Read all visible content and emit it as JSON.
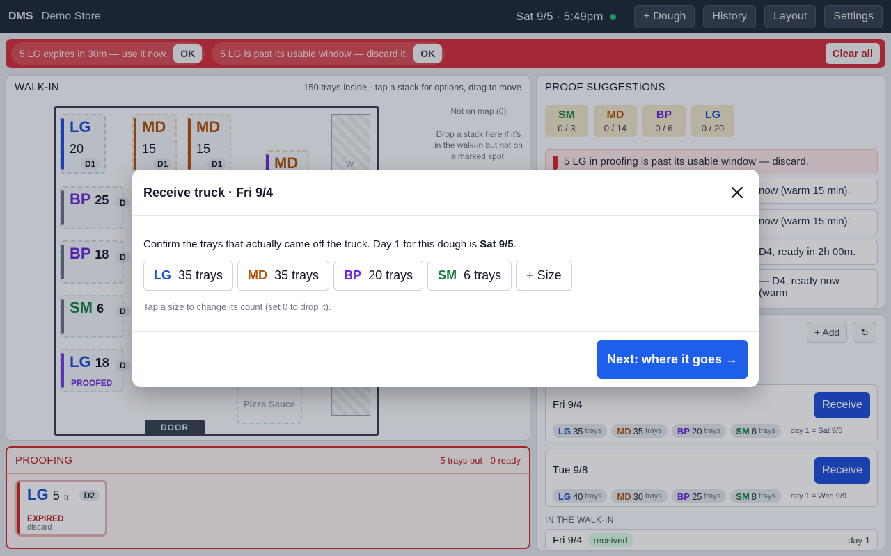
{
  "topbar": {
    "brand": "DMS",
    "store": "Demo Store",
    "datetime": "Sat 9/5 · 5:49pm",
    "buttons": {
      "dough": "+ Dough",
      "history": "History",
      "layout": "Layout",
      "settings": "Settings"
    }
  },
  "alerts": {
    "items": [
      {
        "text": "5 LG expires in 30m — use it now.",
        "ok": "OK"
      },
      {
        "text": "5 LG is past its usable window — discard it.",
        "ok": "OK"
      }
    ],
    "clear_all": "Clear all"
  },
  "walkin": {
    "title": "WALK-IN",
    "meta": "150 trays inside · tap a stack for options, drag to move",
    "stacks": [
      {
        "size": "LG",
        "count": "20",
        "day": "D1"
      },
      {
        "size": "MD",
        "count": "15",
        "day": "D1"
      },
      {
        "size": "MD",
        "count": "15",
        "day": "D1"
      },
      {
        "size": "MD",
        "count": "",
        "day": ""
      },
      {
        "size": "BP",
        "count": "25",
        "day": "D"
      },
      {
        "size": "BP",
        "count": "18",
        "day": "D"
      },
      {
        "size": "SM",
        "count": "6",
        "day": "D"
      },
      {
        "size": "LG",
        "count": "18",
        "day": "D",
        "status": "PROOFED"
      }
    ],
    "wall_label": "W",
    "door": "DOOR",
    "sauce": "Pizza Sauce",
    "not_on_map": "Not on map (0)",
    "not_on_map_help": "Drop a stack here if it's in the walk-in but not on a marked spot."
  },
  "proofing": {
    "title": "PROOFING",
    "meta": "5 trays out · 0 ready",
    "card": {
      "size": "LG",
      "count": "5",
      "unit": "tr",
      "day": "D2",
      "status": "EXPIRED",
      "sub": "discard"
    }
  },
  "suggestions": {
    "title": "PROOF SUGGESTIONS",
    "chips": [
      {
        "size": "SM",
        "value": "0 / 3"
      },
      {
        "size": "MD",
        "value": "0 / 14"
      },
      {
        "size": "BP",
        "value": "0 / 6"
      },
      {
        "size": "LG",
        "value": "0 / 20"
      }
    ],
    "rows": [
      "5 LG in proofing is past its usable window — discard.",
      "now (warm 15 min).",
      "now (warm 15 min).",
      "D4, ready in 2h 00m.",
      "— D4, ready now (warm"
    ]
  },
  "trucks": {
    "add": "+ Add",
    "refresh": "↻",
    "cards": [
      {
        "date": "Fri 9/4",
        "button": "Receive",
        "items": [
          {
            "size": "LG",
            "n": "35"
          },
          {
            "size": "MD",
            "n": "35"
          },
          {
            "size": "BP",
            "n": "20"
          },
          {
            "size": "SM",
            "n": "6"
          }
        ],
        "unit": "trays",
        "day1": "day 1 = Sat 9/5"
      },
      {
        "date": "Tue 9/8",
        "button": "Receive",
        "items": [
          {
            "size": "LG",
            "n": "40"
          },
          {
            "size": "MD",
            "n": "30"
          },
          {
            "size": "BP",
            "n": "25"
          },
          {
            "size": "SM",
            "n": "8"
          }
        ],
        "unit": "trays",
        "day1": "day 1 = Wed 9/9"
      }
    ],
    "section": "IN THE WALK-IN",
    "walkin_card": {
      "date": "Fri 9/4",
      "badge": "received",
      "day": "day 1"
    }
  },
  "modal": {
    "title": "Receive truck · Fri 9/4",
    "desc_prefix": "Confirm the trays that actually came off the truck. Day 1 for this dough is ",
    "desc_day": "Sat 9/5",
    "desc_suffix": ".",
    "sizes": [
      {
        "size": "LG",
        "label": "35 trays"
      },
      {
        "size": "MD",
        "label": "35 trays"
      },
      {
        "size": "BP",
        "label": "20 trays"
      },
      {
        "size": "SM",
        "label": "6 trays"
      }
    ],
    "add_size": "+ Size",
    "hint": "Tap a size to change its count (set 0 to drop it).",
    "next": "Next: where it goes →"
  },
  "colors": {
    "LG": "#1d4ed8",
    "MD": "#b45309",
    "BP": "#6d28d9",
    "SM": "#15803d",
    "alert": "#d32f3a",
    "primary": "#1d5eea"
  }
}
